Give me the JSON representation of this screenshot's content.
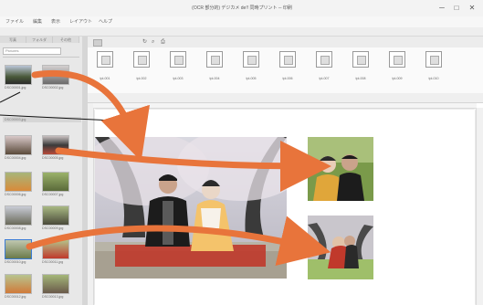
{
  "window": {
    "title": "(OCR 部分的) デジカメ de!! 同時プリント ─ 印刷",
    "minimize": "─",
    "maximize": "□",
    "close": "✕"
  },
  "menu": [
    "ファイル",
    "編集",
    "表示",
    "レイアウト",
    "ヘルプ"
  ],
  "left_panel": {
    "tabs": [
      "写真",
      "フォルダ",
      "その他"
    ],
    "folder": "Pictures",
    "thumbnails": [
      {
        "name": "DSC00001.jpg"
      },
      {
        "name": "DSC00002.jpg"
      },
      {
        "name": "DSC00003.jpg"
      },
      {
        "name": "DSC00004.jpg"
      },
      {
        "name": "DSC00005.jpg"
      },
      {
        "name": "DSC00006.jpg"
      },
      {
        "name": "DSC00007.jpg"
      },
      {
        "name": "DSC00008.jpg"
      },
      {
        "name": "DSC00009.jpg"
      },
      {
        "name": "DSC00010.jpg"
      },
      {
        "name": "DSC00011.jpg"
      },
      {
        "name": "DSC00012.jpg"
      },
      {
        "name": "DSC00013.jpg"
      },
      {
        "name": "DSC00014.jpg"
      }
    ]
  },
  "template_strip": {
    "items": [
      {
        "label": "tpl-001"
      },
      {
        "label": "tpl-002"
      },
      {
        "label": "tpl-003"
      },
      {
        "label": "tpl-004"
      },
      {
        "label": "tpl-005"
      },
      {
        "label": "tpl-006"
      },
      {
        "label": "tpl-007"
      },
      {
        "label": "tpl-008"
      },
      {
        "label": "tpl-009"
      },
      {
        "label": "tpl-010"
      }
    ]
  },
  "colors": {
    "arrow": "#e8743b",
    "sky": "#c9c9d2",
    "kimono_black": "#1c1c1c",
    "kimono_red": "#c0392b",
    "grass": "#8fb35a"
  },
  "icons": [
    "arrow-right-icon",
    "zoom-icon",
    "rotate-icon",
    "print-icon",
    "grid-icon"
  ]
}
